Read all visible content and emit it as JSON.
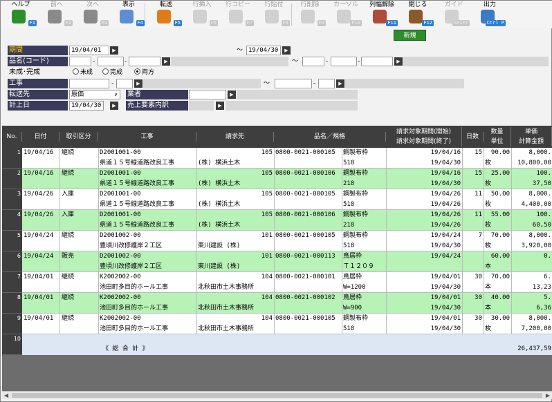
{
  "toolbar": {
    "items": [
      {
        "label": "ヘルプ",
        "key": "F1",
        "icon": "help-icon"
      },
      {
        "label": "前へ",
        "key": "F2",
        "icon": "back-arrow-icon"
      },
      {
        "label": "次へ",
        "key": "F3",
        "icon": "forward-arrow-icon"
      },
      {
        "label": "表示",
        "key": "F4",
        "icon": "magnifier-icon"
      },
      {
        "label": "転送",
        "key": "F5",
        "icon": "transfer-icon"
      },
      {
        "label": "行挿入",
        "key": "F6",
        "icon": "row-insert-icon"
      },
      {
        "label": "行コピー",
        "key": "F7",
        "icon": "row-copy-icon"
      },
      {
        "label": "行貼付",
        "key": "F8",
        "icon": "row-paste-icon"
      },
      {
        "label": "行削除",
        "key": "F9",
        "icon": "row-delete-icon"
      },
      {
        "label": "カーソル",
        "key": "F10",
        "icon": "cursor-icon"
      },
      {
        "label": "列幅解除",
        "key": "F11",
        "icon": "column-width-reset-icon"
      },
      {
        "label": "閉じる",
        "key": "F12",
        "icon": "close-door-icon"
      },
      {
        "label": "ガイド",
        "key": "SHIFT",
        "icon": "guide-bulb-icon"
      },
      {
        "label": "出力",
        "key": "Ctrl P",
        "icon": "printer-icon"
      }
    ],
    "new_label": "新規"
  },
  "form": {
    "period_label": "期間",
    "period_from": "19/04/01",
    "tilde": "～",
    "period_to": "19/04/30",
    "item_label": "品名(コード)",
    "item_from_dash": "-",
    "item_to_dash": "-",
    "status_label": "未成･完成",
    "status_options": [
      "未成",
      "完成",
      "両方"
    ],
    "status_selected": "両方",
    "work_label": "工事",
    "work_dash": "-",
    "dest_label": "転送先",
    "dest_value": "原価",
    "vendor_label": "業者",
    "post_label": "計上日",
    "post_value": "19/04/30",
    "sales_label": "売上要素内訳"
  },
  "grid": {
    "headers": {
      "no": "No.",
      "date": "日付",
      "type": "取引区分",
      "work": "工事",
      "bill": "請求先",
      "item": "品名／規格",
      "period1": "請求対象期間(開始)",
      "period2": "請求対象期間(終了)",
      "days": "日数",
      "qty1": "数量",
      "qty2": "単位",
      "price1": "単価",
      "price2": "計算金額"
    },
    "rows": [
      {
        "no": "1",
        "date": "19/04/16",
        "type": "継続",
        "code": "D2001001-00",
        "site": "県道１５号線道路改良工事",
        "billno": "105",
        "bill": "(株) 横浜土木",
        "item": "0800-0021-000105",
        "name": "鋼製布枠",
        "spec": "518",
        "start": "19/04/16",
        "end": "19/04/30",
        "days": "15",
        "qty": "90.00",
        "unit": "枚",
        "price": "8,000.",
        "amount": "10,800,00",
        "alt": false
      },
      {
        "no": "2",
        "date": "19/04/16",
        "type": "継続",
        "code": "D2001001-00",
        "site": "県道１５号線道路改良工事",
        "billno": "105",
        "bill": "(株) 横浜土木",
        "item": "0800-0021-000106",
        "name": "鋼製布枠",
        "spec": "218",
        "start": "19/04/16",
        "end": "19/04/30",
        "days": "15",
        "qty": "25.00",
        "unit": "枚",
        "price": "100.",
        "amount": "37,50",
        "alt": true
      },
      {
        "no": "3",
        "date": "19/04/26",
        "type": "入庫",
        "code": "D2001001-00",
        "site": "県道１５号線道路改良工事",
        "billno": "105",
        "bill": "(株) 横浜土木",
        "item": "0800-0021-000105",
        "name": "鋼製布枠",
        "spec": "518",
        "start": "19/04/26",
        "end": "19/04/26",
        "days": "11",
        "qty": "50.00",
        "unit": "枚",
        "price": "8,000.",
        "amount": "4,400,00",
        "alt": false
      },
      {
        "no": "4",
        "date": "19/04/26",
        "type": "入庫",
        "code": "D2001001-00",
        "site": "県道１５号線道路改良工事",
        "billno": "105",
        "bill": "(株) 横浜土木",
        "item": "0800-0021-000106",
        "name": "鋼製布枠",
        "spec": "218",
        "start": "19/04/26",
        "end": "19/04/26",
        "days": "11",
        "qty": "55.00",
        "unit": "枚",
        "price": "100.",
        "amount": "60,50",
        "alt": true
      },
      {
        "no": "5",
        "date": "19/04/24",
        "type": "継続",
        "code": "D2001002-00",
        "site": "豊頃川改修護岸２工区",
        "billno": "101",
        "bill": "東川建設 (株)",
        "item": "0800-0021-000105",
        "name": "鋼製布枠",
        "spec": "518",
        "start": "19/04/24",
        "end": "19/04/30",
        "days": "7",
        "qty": "70.00",
        "unit": "枚",
        "price": "8,000.",
        "amount": "3,920,00",
        "alt": false
      },
      {
        "no": "6",
        "date": "19/04/24",
        "type": "販売",
        "code": "D2001002-00",
        "site": "豊頃川改修護岸２工区",
        "billno": "101",
        "bill": "東川建設 (株)",
        "item": "0800-0021-000113",
        "name": "鳥居枠",
        "spec": "Ｔ１２０９",
        "start": "19/04/24",
        "end": "",
        "days": "",
        "qty": "60.00",
        "unit": "本",
        "price": "0.",
        "amount": "",
        "alt": true
      },
      {
        "no": "7",
        "date": "19/04/01",
        "type": "継続",
        "code": "K2002002-00",
        "site": "池田町多目的ホール工事",
        "billno": "104",
        "bill": "北秋田市土木事務所",
        "item": "0800-0021-000101",
        "name": "鳥居枠",
        "spec": "W=1200",
        "start": "19/04/01",
        "end": "19/04/30",
        "days": "30",
        "qty": "70.00",
        "unit": "本",
        "price": "6.",
        "amount": "13,23",
        "alt": false
      },
      {
        "no": "8",
        "date": "19/04/01",
        "type": "継続",
        "code": "K2002002-00",
        "site": "池田町多目的ホール工事",
        "billno": "104",
        "bill": "北秋田市土木事務所",
        "item": "0800-0021-000102",
        "name": "鳥居枠",
        "spec": "W=900",
        "start": "19/04/01",
        "end": "19/04/30",
        "days": "30",
        "qty": "40.00",
        "unit": "本",
        "price": "5.",
        "amount": "6,36",
        "alt": true
      },
      {
        "no": "9",
        "date": "19/04/01",
        "type": "継続",
        "code": "K2002002-00",
        "site": "池田町多目的ホール工事",
        "billno": "104",
        "bill": "北秋田市土木事務所",
        "item": "0800-0021-000105",
        "name": "鋼製布枠",
        "spec": "518",
        "start": "19/04/01",
        "end": "19/04/30",
        "days": "30",
        "qty": "30.00",
        "unit": "枚",
        "price": "8,000.",
        "amount": "7,200,00",
        "alt": false
      }
    ],
    "total_no": "10",
    "total_label": "《 総 合 計 》",
    "total_amount": "26,437,59"
  }
}
